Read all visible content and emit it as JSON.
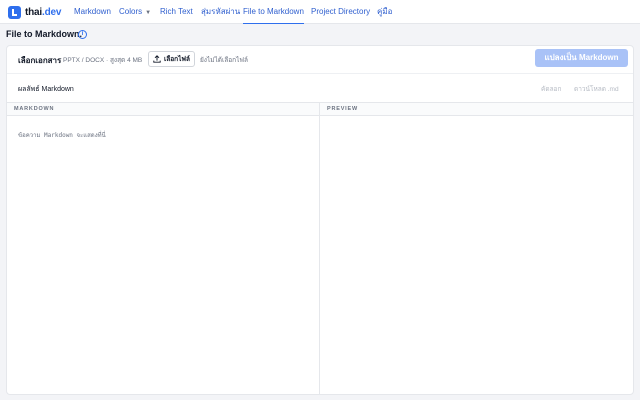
{
  "nav": {
    "logo_main": "thai",
    "logo_suffix": ".dev",
    "items": [
      {
        "label": "Markdown"
      },
      {
        "label": "Colors"
      },
      {
        "label": "Rich Text"
      },
      {
        "label": "สุ่มรหัสผ่าน"
      },
      {
        "label": "File to Markdown",
        "active": true
      },
      {
        "label": "Project Directory"
      },
      {
        "label": "คู่มือ"
      }
    ]
  },
  "page": {
    "title": "File to Markdown.",
    "info_icon": "info-icon"
  },
  "upload": {
    "title": "เลือกเอกสาร",
    "hint": "PPTX / DOCX · สูงสุด 4 MB",
    "choose_label": "เลือกไฟล์",
    "no_file_text": "ยังไม่ได้เลือกไฟล์",
    "convert_label": "แปลงเป็น Markdown"
  },
  "result": {
    "title": "ผลลัพธ์ Markdown",
    "copy_label": "คัดลอก",
    "download_label": "ดาวน์โหลด .md"
  },
  "panes": {
    "markdown_label": "MARKDOWN",
    "preview_label": "PREVIEW",
    "editor_placeholder": "ข้อความ Markdown จะแสดงที่นี่"
  },
  "colors": {
    "accent": "#2f6fed",
    "convert_disabled": "#a9c2f7",
    "background": "#f3f4f7"
  }
}
